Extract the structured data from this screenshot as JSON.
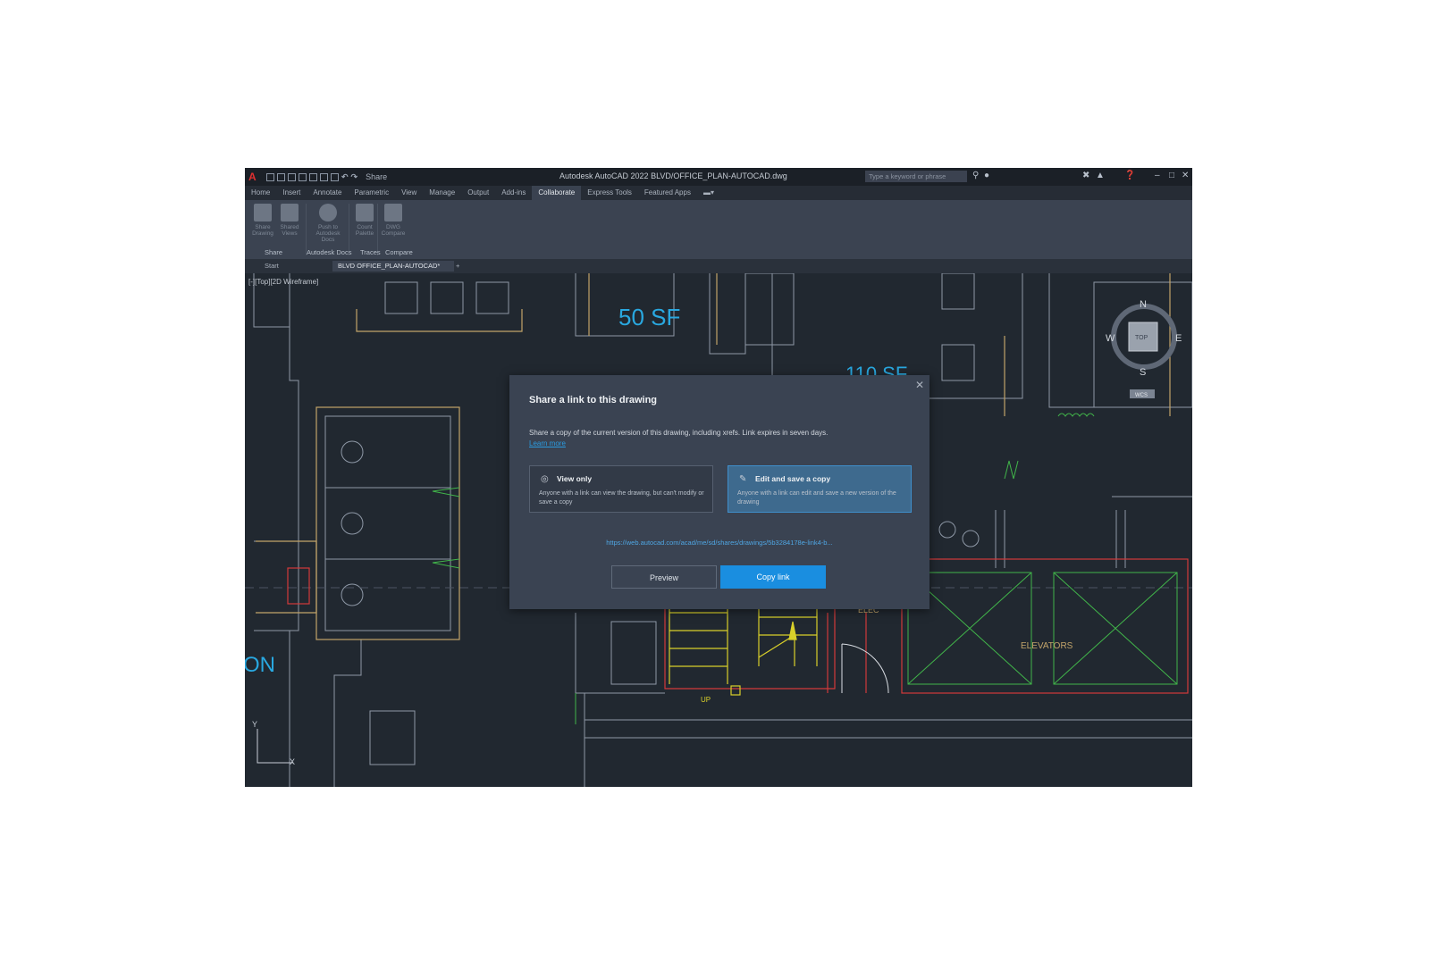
{
  "titlebar": {
    "app_letter": "A",
    "title": "Autodesk AutoCAD 2022   BLVD/OFFICE_PLAN-AUTOCAD.dwg",
    "share_label": "Share",
    "search_placeholder": "Type a keyword or phrase"
  },
  "menu": {
    "tabs": [
      "Home",
      "Insert",
      "Annotate",
      "Parametric",
      "View",
      "Manage",
      "Output",
      "Add-ins",
      "Collaborate",
      "Express Tools",
      "Featured Apps"
    ],
    "active": "Collaborate"
  },
  "ribbon": {
    "buttons": [
      "Share Drawing",
      "Shared Views",
      "Push to Autodesk Docs",
      "Count Palette",
      "DWG Compare"
    ],
    "groups": [
      "Share",
      "Autodesk Docs",
      "Traces",
      "Compare"
    ]
  },
  "doc_tabs": {
    "start": "Start",
    "active": "BLVD OFFICE_PLAN-AUTOCAD*"
  },
  "canvas": {
    "viewport_label": "[-][Top][2D Wireframe]",
    "room_area_1": "50 SF",
    "room_area_2": "110 SF",
    "elevators_label": "ELEVATORS",
    "elec_label": "ELEC",
    "up_label": "UP",
    "left_text": "ON",
    "viewcube": {
      "n": "N",
      "s": "S",
      "e": "E",
      "w": "W",
      "top": "TOP",
      "wcs": "WCS"
    },
    "ucs_y": "Y",
    "ucs_x": "X"
  },
  "dialog": {
    "title": "Share a link to this drawing",
    "description": "Share a copy of the current version of this drawing, including xrefs. Link expires in seven days.",
    "learn_more": "Learn more",
    "options": [
      {
        "title": "View only",
        "desc": "Anyone with a link can view the drawing, but can't modify or save a copy",
        "icon": "eye-icon"
      },
      {
        "title": "Edit and save a copy",
        "desc": "Anyone with a link can edit and save a new version of the drawing",
        "icon": "pencil-icon"
      }
    ],
    "selected_option": 1,
    "url": "https://web.autocad.com/acad/me/sd/shares/drawings/5b3284178e-link4-b...",
    "preview_button": "Preview",
    "copy_button": "Copy link"
  },
  "colors": {
    "accent": "#1a8ee0",
    "canvas_bg": "#212830",
    "dialog_bg": "#3a4352"
  }
}
